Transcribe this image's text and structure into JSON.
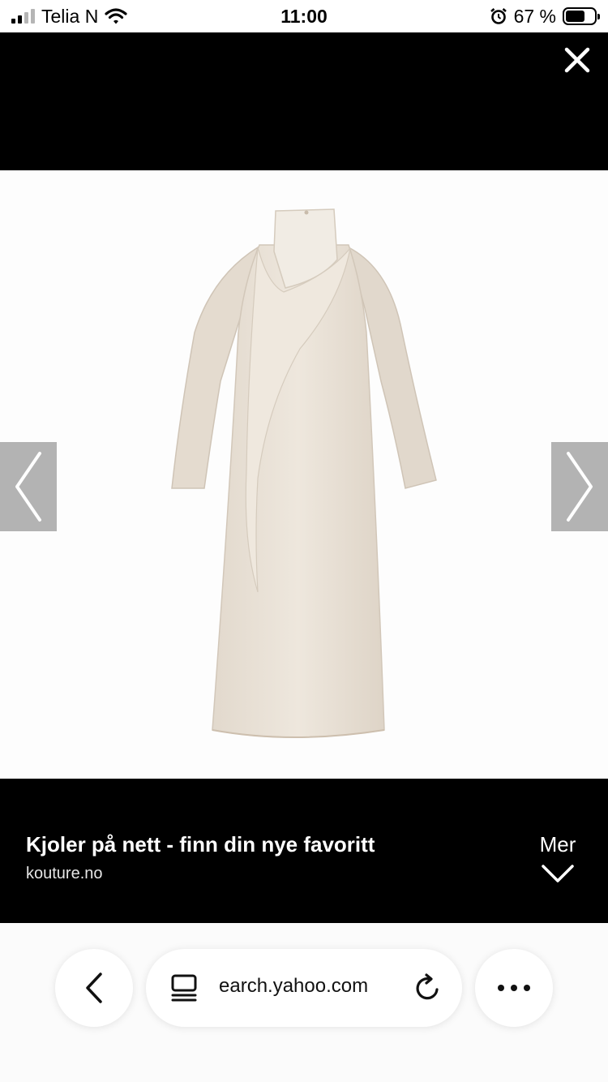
{
  "status_bar": {
    "carrier": "Telia N",
    "time": "11:00",
    "battery_percent": "67 %",
    "battery_level": 0.67,
    "icons": [
      "signal-icon",
      "wifi-icon",
      "alarm-icon",
      "battery-icon"
    ]
  },
  "viewer": {
    "close_icon": "close-icon",
    "prev_icon": "chevron-left-icon",
    "next_icon": "chevron-right-icon",
    "image_alt": "beige dress"
  },
  "caption": {
    "title": "Kjoler på nett - finn din nye favoritt",
    "source": "kouture.no",
    "more_label": "Mer",
    "more_icon": "chevron-down-icon"
  },
  "browser": {
    "url_text": "earch.yahoo.com",
    "back_icon": "chevron-left-icon",
    "tabs_icon": "tabs-icon",
    "reload_icon": "reload-icon",
    "menu_icon": "more-icon"
  },
  "colors": {
    "background": "#000000",
    "image_background": "#fdfdfd",
    "dress": "#e9e1d6"
  }
}
